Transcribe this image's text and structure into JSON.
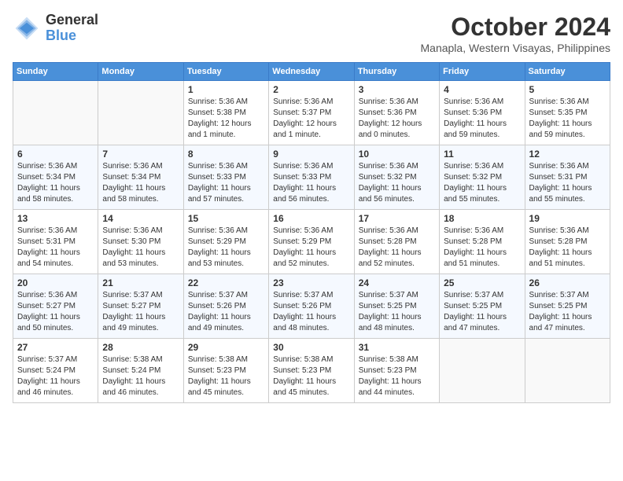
{
  "header": {
    "logo_line1": "General",
    "logo_line2": "Blue",
    "month": "October 2024",
    "location": "Manapla, Western Visayas, Philippines"
  },
  "columns": [
    "Sunday",
    "Monday",
    "Tuesday",
    "Wednesday",
    "Thursday",
    "Friday",
    "Saturday"
  ],
  "weeks": [
    [
      {
        "day": "",
        "info": ""
      },
      {
        "day": "",
        "info": ""
      },
      {
        "day": "1",
        "info": "Sunrise: 5:36 AM\nSunset: 5:38 PM\nDaylight: 12 hours\nand 1 minute."
      },
      {
        "day": "2",
        "info": "Sunrise: 5:36 AM\nSunset: 5:37 PM\nDaylight: 12 hours\nand 1 minute."
      },
      {
        "day": "3",
        "info": "Sunrise: 5:36 AM\nSunset: 5:36 PM\nDaylight: 12 hours\nand 0 minutes."
      },
      {
        "day": "4",
        "info": "Sunrise: 5:36 AM\nSunset: 5:36 PM\nDaylight: 11 hours\nand 59 minutes."
      },
      {
        "day": "5",
        "info": "Sunrise: 5:36 AM\nSunset: 5:35 PM\nDaylight: 11 hours\nand 59 minutes."
      }
    ],
    [
      {
        "day": "6",
        "info": "Sunrise: 5:36 AM\nSunset: 5:34 PM\nDaylight: 11 hours\nand 58 minutes."
      },
      {
        "day": "7",
        "info": "Sunrise: 5:36 AM\nSunset: 5:34 PM\nDaylight: 11 hours\nand 58 minutes."
      },
      {
        "day": "8",
        "info": "Sunrise: 5:36 AM\nSunset: 5:33 PM\nDaylight: 11 hours\nand 57 minutes."
      },
      {
        "day": "9",
        "info": "Sunrise: 5:36 AM\nSunset: 5:33 PM\nDaylight: 11 hours\nand 56 minutes."
      },
      {
        "day": "10",
        "info": "Sunrise: 5:36 AM\nSunset: 5:32 PM\nDaylight: 11 hours\nand 56 minutes."
      },
      {
        "day": "11",
        "info": "Sunrise: 5:36 AM\nSunset: 5:32 PM\nDaylight: 11 hours\nand 55 minutes."
      },
      {
        "day": "12",
        "info": "Sunrise: 5:36 AM\nSunset: 5:31 PM\nDaylight: 11 hours\nand 55 minutes."
      }
    ],
    [
      {
        "day": "13",
        "info": "Sunrise: 5:36 AM\nSunset: 5:31 PM\nDaylight: 11 hours\nand 54 minutes."
      },
      {
        "day": "14",
        "info": "Sunrise: 5:36 AM\nSunset: 5:30 PM\nDaylight: 11 hours\nand 53 minutes."
      },
      {
        "day": "15",
        "info": "Sunrise: 5:36 AM\nSunset: 5:29 PM\nDaylight: 11 hours\nand 53 minutes."
      },
      {
        "day": "16",
        "info": "Sunrise: 5:36 AM\nSunset: 5:29 PM\nDaylight: 11 hours\nand 52 minutes."
      },
      {
        "day": "17",
        "info": "Sunrise: 5:36 AM\nSunset: 5:28 PM\nDaylight: 11 hours\nand 52 minutes."
      },
      {
        "day": "18",
        "info": "Sunrise: 5:36 AM\nSunset: 5:28 PM\nDaylight: 11 hours\nand 51 minutes."
      },
      {
        "day": "19",
        "info": "Sunrise: 5:36 AM\nSunset: 5:28 PM\nDaylight: 11 hours\nand 51 minutes."
      }
    ],
    [
      {
        "day": "20",
        "info": "Sunrise: 5:36 AM\nSunset: 5:27 PM\nDaylight: 11 hours\nand 50 minutes."
      },
      {
        "day": "21",
        "info": "Sunrise: 5:37 AM\nSunset: 5:27 PM\nDaylight: 11 hours\nand 49 minutes."
      },
      {
        "day": "22",
        "info": "Sunrise: 5:37 AM\nSunset: 5:26 PM\nDaylight: 11 hours\nand 49 minutes."
      },
      {
        "day": "23",
        "info": "Sunrise: 5:37 AM\nSunset: 5:26 PM\nDaylight: 11 hours\nand 48 minutes."
      },
      {
        "day": "24",
        "info": "Sunrise: 5:37 AM\nSunset: 5:25 PM\nDaylight: 11 hours\nand 48 minutes."
      },
      {
        "day": "25",
        "info": "Sunrise: 5:37 AM\nSunset: 5:25 PM\nDaylight: 11 hours\nand 47 minutes."
      },
      {
        "day": "26",
        "info": "Sunrise: 5:37 AM\nSunset: 5:25 PM\nDaylight: 11 hours\nand 47 minutes."
      }
    ],
    [
      {
        "day": "27",
        "info": "Sunrise: 5:37 AM\nSunset: 5:24 PM\nDaylight: 11 hours\nand 46 minutes."
      },
      {
        "day": "28",
        "info": "Sunrise: 5:38 AM\nSunset: 5:24 PM\nDaylight: 11 hours\nand 46 minutes."
      },
      {
        "day": "29",
        "info": "Sunrise: 5:38 AM\nSunset: 5:23 PM\nDaylight: 11 hours\nand 45 minutes."
      },
      {
        "day": "30",
        "info": "Sunrise: 5:38 AM\nSunset: 5:23 PM\nDaylight: 11 hours\nand 45 minutes."
      },
      {
        "day": "31",
        "info": "Sunrise: 5:38 AM\nSunset: 5:23 PM\nDaylight: 11 hours\nand 44 minutes."
      },
      {
        "day": "",
        "info": ""
      },
      {
        "day": "",
        "info": ""
      }
    ]
  ]
}
